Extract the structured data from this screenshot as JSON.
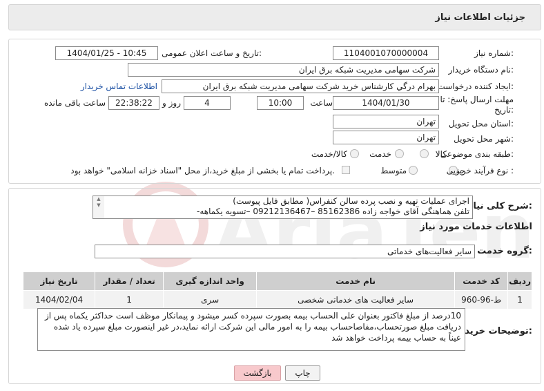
{
  "header": {
    "title": "جزئیات اطلاعات نیاز"
  },
  "form": {
    "need_number_label": "شماره نیاز:",
    "need_number": "1104001070000004",
    "announce_label": "تاریخ و ساعت اعلان عمومی:",
    "announce_value": "1404/01/25 - 10:45",
    "buyer_org_label": "نام دستگاه خریدار:",
    "buyer_org": "شرکت سهامی مدیریت شبکه برق ایران",
    "creator_label": "ایجاد کننده درخواست:",
    "creator": "بهرام درگي كارشناس خريد شرکت سهامی مدیریت شبکه برق ایران",
    "contact_link": "اطلاعات تماس خریدار",
    "deadline_label_1": "مهلت ارسال پاسخ: تا",
    "deadline_label_2": "تاریخ:",
    "deadline_date": "1404/01/30",
    "time_label": "ساعت",
    "deadline_time": "10:00",
    "days_value": "4",
    "days_label": "روز و",
    "remaining_time": "22:38:22",
    "remaining_label": "ساعت باقی مانده",
    "province_label": "استان محل تحویل:",
    "province": "تهران",
    "city_label": "شهر محل تحویل:",
    "city": "تهران",
    "category_label": "طبقه بندی موضوعی:",
    "category_options": [
      "کالا",
      "کالا/خدمت",
      "خدمت"
    ],
    "process_label": "نوع فرآیند خرید :",
    "process_options": [
      "جزیی",
      "متوسط"
    ],
    "payment_note": "پرداخت تمام یا بخشی از مبلغ خرید،از محل \"اسناد خزانه اسلامی\" خواهد بود."
  },
  "general_desc": {
    "label": "شرح کلی نیاز:",
    "line1": "اجرای عملیات تهیه و نصب پرده سالن کنفراس( مطابق فایل پیوست)",
    "line2": "تلفن هماهنگی آقای خواجه زاده 85162386 –09212136467 –تسویه یکماهه-"
  },
  "services": {
    "section_title": "اطلاعات خدمات مورد نیاز",
    "group_label": "گروه خدمت:",
    "group_value": "سایر فعالیت‌های خدماتی",
    "columns": [
      "ردیف",
      "کد خدمت",
      "نام خدمت",
      "واحد اندازه گیری",
      "تعداد / مقدار",
      "تاریخ نیاز"
    ],
    "rows": [
      {
        "row": "1",
        "code": "ط-96-960",
        "name": "سایر فعالیت های خدماتی شخصی",
        "unit": "سری",
        "qty": "1",
        "date": "1404/02/04"
      }
    ]
  },
  "buyer_notes": {
    "label": "توضیحات خریدار:",
    "text": "10درصد از مبلغ فاکتور بعنوان علی الحساب بیمه بصورت سپرده کسر میشود و پیمانکار موظف است حداکثر یکماه پس از دریافت مبلغ صورتحساب،مفاصاحساب بیمه را به امور مالی این شرکت ارائه نماید،در غیر اینصورت مبلغ سپرده یاد شده عیناً به حساب بیمه پرداخت خواهد شد"
  },
  "buttons": {
    "print": "چاپ",
    "back": "بازگشت"
  },
  "watermark": "AriaTender.neT",
  "colors": {
    "panel_border": "#d6d6d6",
    "header_bg": "#ececec",
    "back_button_bg": "#f8c9cc"
  }
}
